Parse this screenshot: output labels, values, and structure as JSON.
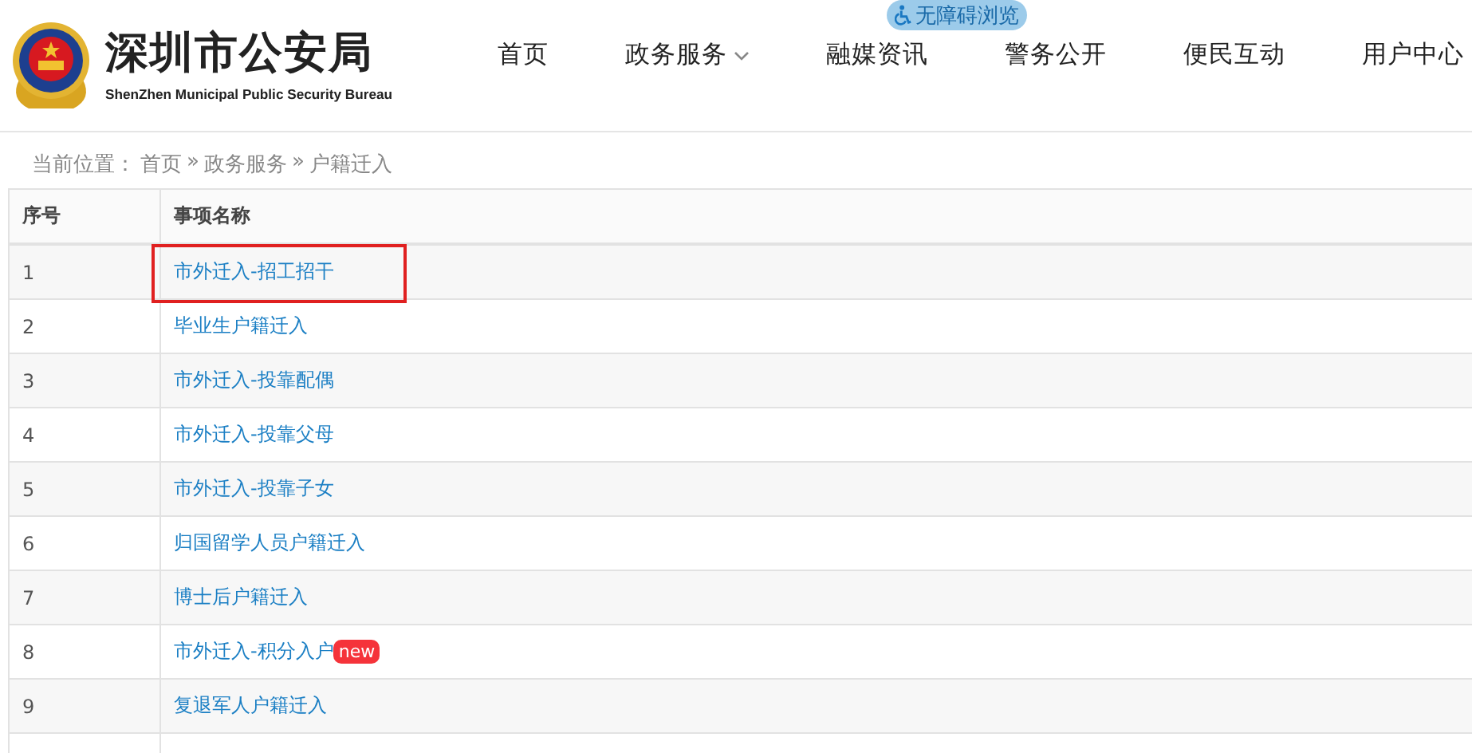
{
  "header": {
    "title": "深圳市公安局",
    "subtitle": "ShenZhen Municipal Public Security Bureau",
    "accessibility_badge": "无障碍浏览",
    "nav": [
      {
        "label": "首页",
        "dropdown": false
      },
      {
        "label": "政务服务",
        "dropdown": true
      },
      {
        "label": "融媒资讯",
        "dropdown": false
      },
      {
        "label": "警务公开",
        "dropdown": false
      },
      {
        "label": "便民互动",
        "dropdown": false
      },
      {
        "label": "用户中心",
        "dropdown": false
      }
    ]
  },
  "breadcrumb": {
    "prefix": "当前位置：",
    "items": [
      "首页",
      "政务服务",
      "户籍迁入"
    ],
    "separator": "»"
  },
  "table": {
    "columns": [
      "序号",
      "事项名称"
    ],
    "rows": [
      {
        "index": "1",
        "name": "市外迁入-招工招干",
        "highlighted": true
      },
      {
        "index": "2",
        "name": "毕业生户籍迁入",
        "highlighted": false
      },
      {
        "index": "3",
        "name": "市外迁入-投靠配偶",
        "highlighted": false
      },
      {
        "index": "4",
        "name": "市外迁入-投靠父母",
        "highlighted": false
      },
      {
        "index": "5",
        "name": "市外迁入-投靠子女",
        "highlighted": false
      },
      {
        "index": "6",
        "name": "归国留学人员户籍迁入",
        "highlighted": false
      },
      {
        "index": "7",
        "name": "博士后户籍迁入",
        "highlighted": false
      },
      {
        "index": "8",
        "name": "市外迁入-积分入户",
        "highlighted": false,
        "badge": "new"
      },
      {
        "index": "9",
        "name": "复退军人户籍迁入",
        "highlighted": false
      }
    ]
  }
}
